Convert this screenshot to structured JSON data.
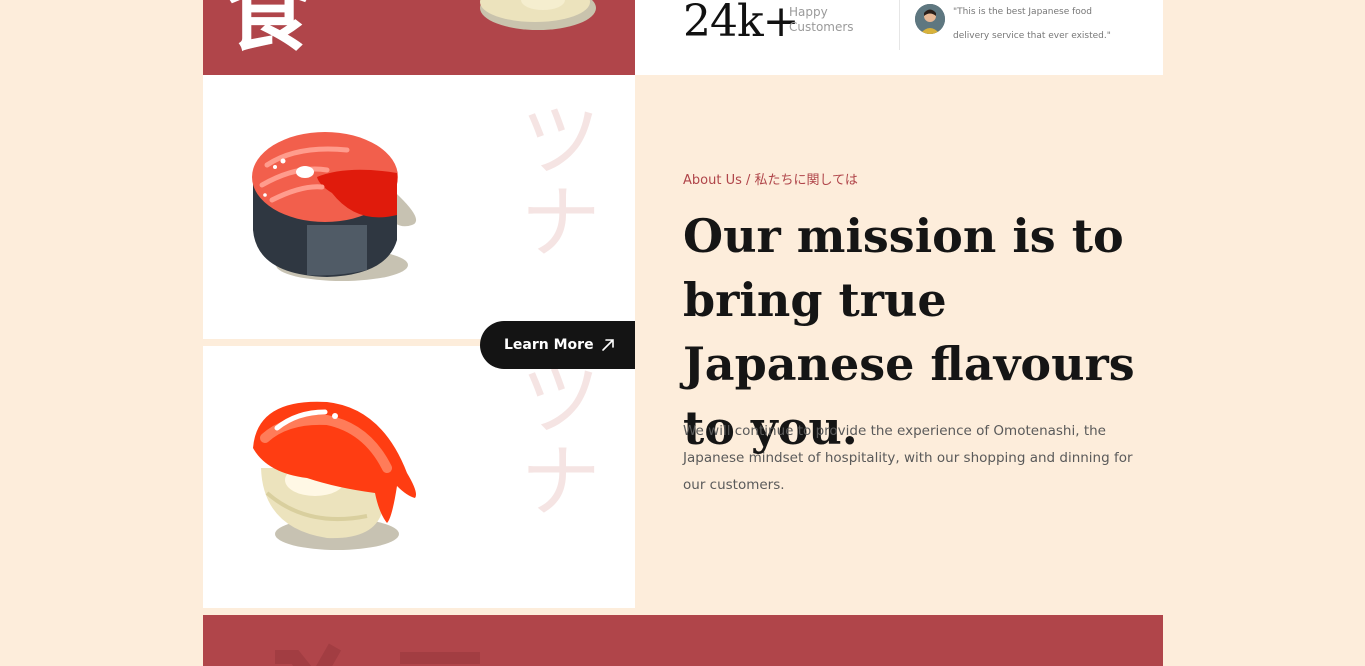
{
  "hero": {
    "kanji": "食"
  },
  "stats": {
    "count": "24k+",
    "label": "Happy Customers"
  },
  "testimonial": {
    "quote": "\"This is the best Japanese food delivery service that ever existed.\""
  },
  "panels": {
    "katakana_top": "ツナ",
    "katakana_bottom": "ツナ"
  },
  "cta": {
    "label": "Learn More",
    "icon": "arrow-up-right-icon"
  },
  "about": {
    "eyebrow": "About Us / 私たちに関しては",
    "headline": "Our mission is to bring true Japanese flavours to you.",
    "body": "We will continue to provide the experience of Omotenashi, the Japanese mindset of hospitality, with our shopping and dinning for our customers."
  },
  "colors": {
    "background": "#fdeddb",
    "accent_red": "#b0454a",
    "dark": "#141414"
  }
}
